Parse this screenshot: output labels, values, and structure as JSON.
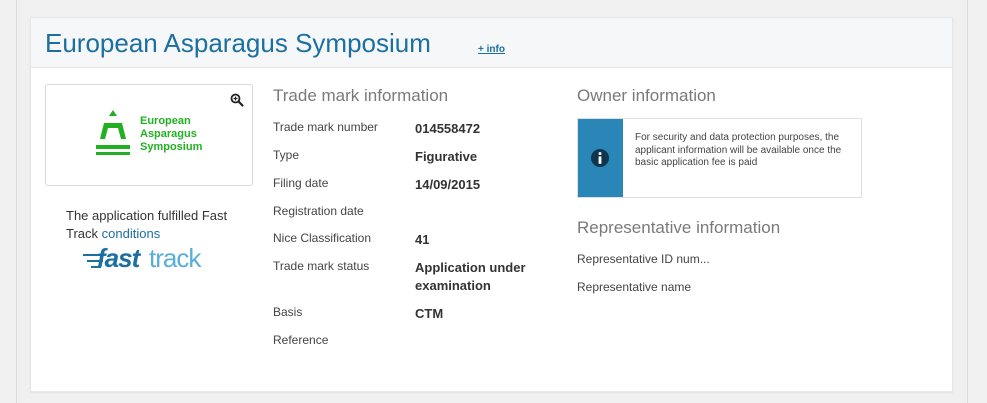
{
  "header": {
    "title": "European Asparagus Symposium",
    "more_info": "+ info"
  },
  "mark_image": {
    "logo_lines": [
      "European",
      "Asparagus",
      "Symposium"
    ],
    "logo_color": "#22b022"
  },
  "fast_track": {
    "text": "The application fulfilled Fast Track",
    "link": "conditions",
    "logo_text": "fast track"
  },
  "trade_mark": {
    "section_title": "Trade mark information",
    "rows": [
      {
        "label": "Trade mark number",
        "value": "014558472"
      },
      {
        "label": "Type",
        "value": "Figurative"
      },
      {
        "label": "Filing date",
        "value": "14/09/2015"
      },
      {
        "label": "Registration date",
        "value": ""
      },
      {
        "label": "Nice Classification",
        "value": "41"
      },
      {
        "label": "Trade mark status",
        "value": "Application under examination"
      },
      {
        "label": "Basis",
        "value": "CTM"
      },
      {
        "label": "Reference",
        "value": ""
      }
    ]
  },
  "owner": {
    "section_title": "Owner information",
    "notice": "For security and data protection purposes, the applicant information will be available once the basic application fee is paid"
  },
  "representative": {
    "section_title": "Representative information",
    "rows": [
      {
        "label": "Representative ID num..."
      },
      {
        "label": "Representative name"
      }
    ]
  },
  "colors": {
    "accent": "#1b6fa1",
    "notice_bar": "#2a86b6",
    "section_title": "#7a7a7a"
  }
}
